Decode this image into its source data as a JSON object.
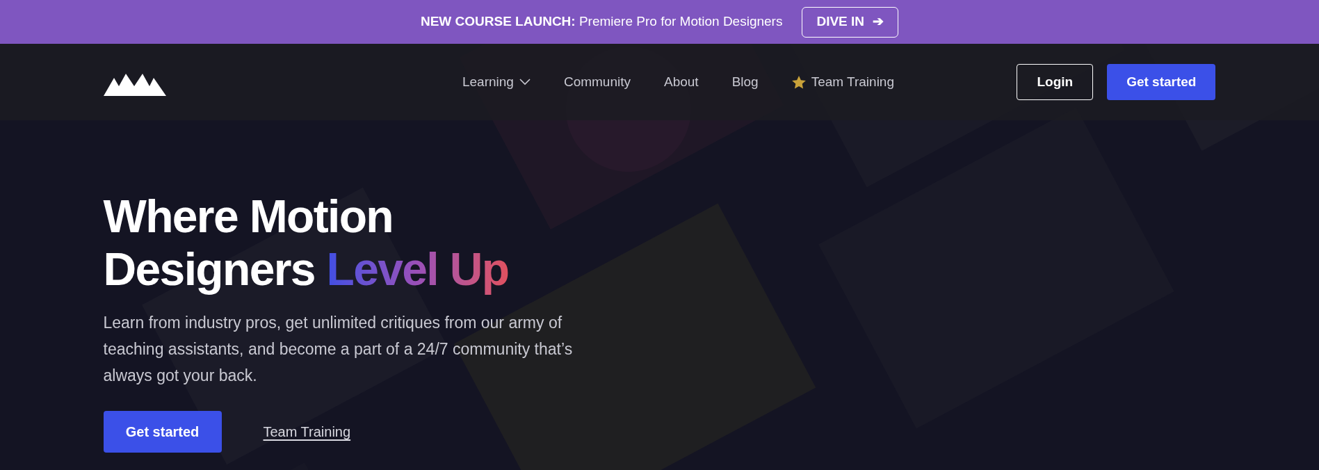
{
  "announcement": {
    "label": "NEW COURSE LAUNCH:",
    "text": "Premiere Pro for Motion Designers",
    "button": "DIVE IN",
    "button_icon": "➔"
  },
  "nav": {
    "items": [
      {
        "label": "Learning",
        "kind": "dropdown"
      },
      {
        "label": "Community",
        "kind": "link"
      },
      {
        "label": "About",
        "kind": "link"
      },
      {
        "label": "Blog",
        "kind": "link"
      },
      {
        "label": "Team Training",
        "kind": "starred"
      }
    ],
    "login": "Login",
    "cta": "Get started"
  },
  "hero": {
    "kind": "picture",
    "title_start": "Where Motion Designers",
    "title_highlight": "Level Up",
    "text": "Learn from industry pros, get unlimited critiques from our army of teaching assistants, and become a part of a 24/7 community that’s always got your back.",
    "primary": "Get started",
    "secondary": "Team Training"
  }
}
